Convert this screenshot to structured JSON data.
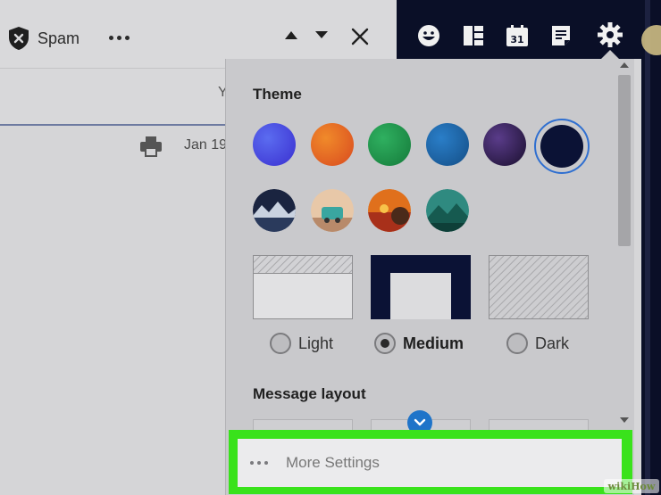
{
  "toolbar": {
    "spam_label": "Spam"
  },
  "email": {
    "header_fragment": "Y",
    "date": "Jan 19"
  },
  "theme": {
    "title": "Theme",
    "swatches": [
      "#3a3fd8",
      "#e06a1e",
      "#1e9a46",
      "#1a6ab0",
      "#2c1845",
      "#0b1235"
    ],
    "selected_swatch": 5,
    "photo_themes": [
      "mountain-lake",
      "camper-van",
      "autumn-sunset",
      "green-mountains"
    ],
    "appearance_options": [
      {
        "label": "Light",
        "selected": false
      },
      {
        "label": "Medium",
        "selected": true
      },
      {
        "label": "Dark",
        "selected": false
      }
    ]
  },
  "message_layout": {
    "title": "Message layout"
  },
  "more_settings": {
    "label": "More Settings"
  },
  "watermark": {
    "text": "wikiHow"
  },
  "icons": {
    "spam": "shield-x-icon",
    "more": "more-horizontal-icon",
    "prev": "triangle-up-icon",
    "next": "triangle-down-icon",
    "close": "close-icon",
    "print": "printer-icon",
    "contacts": "emoji-icon",
    "apps": "columns-icon",
    "calendar": "calendar-icon",
    "notepad": "notepad-icon",
    "settings": "gear-icon"
  },
  "colors": {
    "nav_bg": "#0a0f27",
    "panel_bg": "#c9c9cc",
    "highlight": "#39e21b",
    "accent": "#1f74c9"
  }
}
